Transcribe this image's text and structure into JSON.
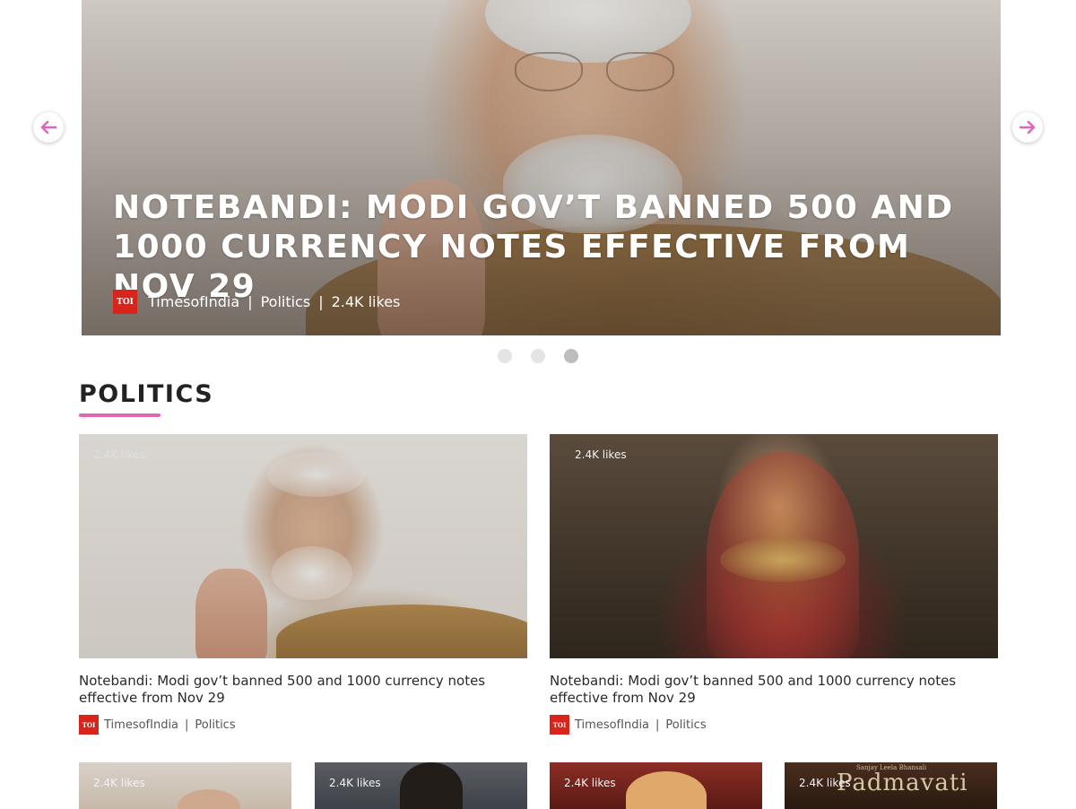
{
  "hero": {
    "title": "NOTEBANDI: MODI GOV’T BANNED 500 AND 1000 CURRENCY NOTES EFFECTIVE FROM NOV 29",
    "logo_text": "TOI",
    "source": "TimesofIndia",
    "category": "Politics",
    "likes": "2.4K likes",
    "separator": "|",
    "slides": 3,
    "active_slide": 3
  },
  "section": {
    "title": "POLITICS",
    "accent_color": "#e066b8"
  },
  "featured_cards": [
    {
      "likes": "2.4K likes",
      "title": "Notebandi: Modi gov’t banned 500 and 1000 currency notes effective from Nov 29",
      "logo_text": "TOI",
      "source": "TimesofIndia",
      "separator": "|",
      "category": "Politics"
    },
    {
      "likes": "2.4K likes",
      "title": "Notebandi: Modi gov’t banned 500 and 1000 currency notes effective from Nov 29",
      "logo_text": "TOI",
      "source": "TimesofIndia",
      "separator": "|",
      "category": "Politics"
    }
  ],
  "small_cards": [
    {
      "likes": "2.4K likes"
    },
    {
      "likes": "2.4K likes"
    },
    {
      "likes": "2.4K likes"
    },
    {
      "likes": "2.4K likes",
      "poster_text": "Padmavati",
      "poster_subtext": "Sanjay Leela Bhansali"
    }
  ],
  "icons": {
    "prev": "arrow-left-icon",
    "next": "arrow-right-icon",
    "arrow_color": "#e066b8",
    "logo_color": "#d9241b"
  }
}
